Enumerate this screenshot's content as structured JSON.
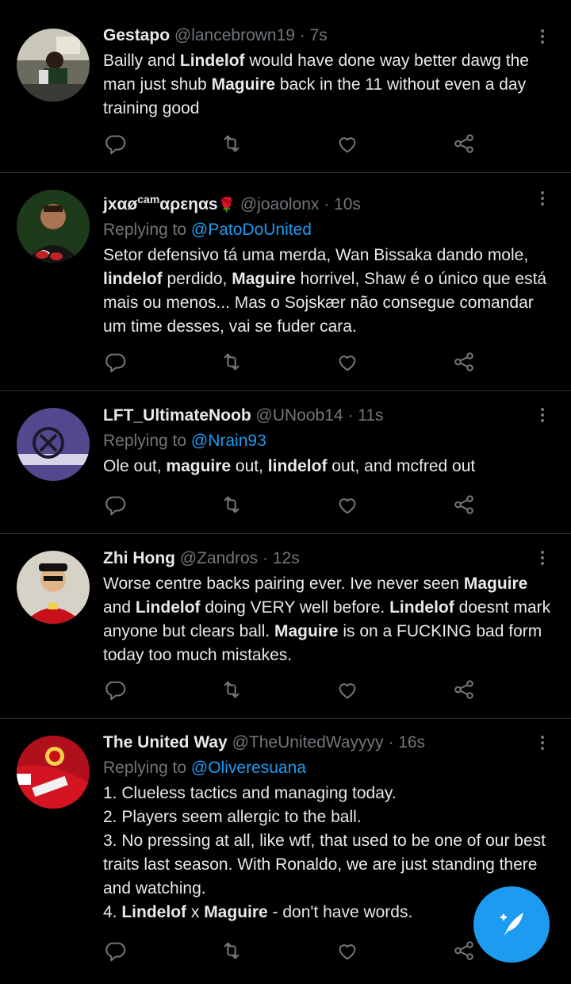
{
  "tweets": [
    {
      "name": "Gestapo",
      "handle": "@lancebrown19",
      "sep": " · ",
      "time": "7s",
      "replying_prefix": "",
      "replying_to": "",
      "text": [
        {
          "t": "Bailly and "
        },
        {
          "t": "Lindelof",
          "b": true
        },
        {
          "t": " would have done way better dawg the man just shub "
        },
        {
          "t": "Maguire",
          "b": true
        },
        {
          "t": " back in the 11 without even a day training good"
        }
      ]
    },
    {
      "name": "jxαø",
      "name_sup": "cam",
      "name_rest": "αρεηαs",
      "name_emoji": "🌹",
      "handle": "@joaolonx",
      "sep": " · ",
      "time": "10s",
      "replying_prefix": "Replying to ",
      "replying_to": "@PatoDoUnited",
      "text": [
        {
          "t": "Setor defensivo tá uma merda, Wan Bissaka dando mole, "
        },
        {
          "t": "lindelof",
          "b": true
        },
        {
          "t": " perdido, "
        },
        {
          "t": "Maguire",
          "b": true
        },
        {
          "t": " horrivel, Shaw é o único que está mais ou menos... Mas o Sojskær não consegue comandar um time desses, vai se fuder cara."
        }
      ]
    },
    {
      "name": "LFT_UltimateNoob",
      "handle": "@UNoob14",
      "sep": " · ",
      "time": "11s",
      "replying_prefix": "Replying to ",
      "replying_to": "@Nrain93",
      "text": [
        {
          "t": "Ole out, "
        },
        {
          "t": "maguire",
          "b": true
        },
        {
          "t": " out, "
        },
        {
          "t": "lindelof",
          "b": true
        },
        {
          "t": " out, and mcfred out"
        }
      ]
    },
    {
      "name": "Zhi Hong",
      "handle": "@Zandros",
      "sep": " · ",
      "time": "12s",
      "replying_prefix": "",
      "replying_to": "",
      "text": [
        {
          "t": "Worse centre backs pairing ever. Ive never seen "
        },
        {
          "t": "Maguire",
          "b": true
        },
        {
          "t": " and "
        },
        {
          "t": "Lindelof",
          "b": true
        },
        {
          "t": " doing VERY well before. "
        },
        {
          "t": "Lindelof",
          "b": true
        },
        {
          "t": " doesnt mark anyone but clears ball. "
        },
        {
          "t": "Maguire",
          "b": true
        },
        {
          "t": " is on a FUCKING bad form today too much mistakes."
        }
      ]
    },
    {
      "name": "The United Way",
      "handle": "@TheUnitedWayyyy",
      "sep": " · ",
      "time": "16s",
      "replying_prefix": "Replying to ",
      "replying_to": "@Oliveresuana",
      "text": [
        {
          "t": "1. Clueless tactics and managing today."
        },
        {
          "br": true
        },
        {
          "t": "2. Players seem allergic to the ball."
        },
        {
          "br": true
        },
        {
          "t": "3. No pressing at all, like wtf, that used to be one of our best traits last season. With Ronaldo, we are just standing there and watching."
        },
        {
          "br": true
        },
        {
          "t": "4. "
        },
        {
          "t": "Lindelof",
          "b": true
        },
        {
          "t": " x "
        },
        {
          "t": "Maguire",
          "b": true
        },
        {
          "t": " - don't have words."
        }
      ]
    }
  ],
  "icons": {
    "reply": "reply-icon",
    "retweet": "retweet-icon",
    "like": "like-icon",
    "share": "share-icon",
    "more": "more-icon",
    "compose": "compose-tweet-icon"
  },
  "colors": {
    "background": "#000000",
    "text": "#e7e9ea",
    "muted": "#71767b",
    "accent": "#1d9bf0",
    "divider": "#2f3336"
  }
}
